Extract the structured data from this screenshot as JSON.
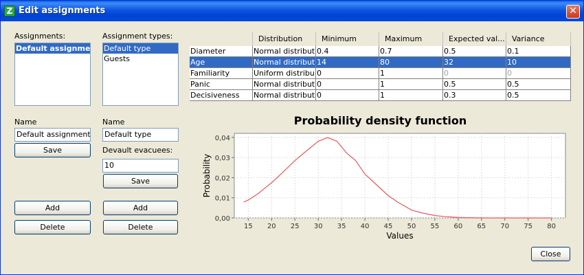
{
  "window": {
    "title": "Edit assignments",
    "app_icon_letter": "Z",
    "close_glyph": "✕"
  },
  "assignments": {
    "label": "Assignments:",
    "items": [
      {
        "label": "Default assignment",
        "selected": true
      }
    ]
  },
  "assignment_types": {
    "label": "Assignment types:",
    "items": [
      {
        "label": "Default type",
        "selected": true
      },
      {
        "label": "Guests",
        "selected": false
      }
    ]
  },
  "assignment_form": {
    "name_label": "Name",
    "name_value": "Default assignment",
    "save_label": "Save",
    "add_label": "Add",
    "delete_label": "Delete"
  },
  "type_form": {
    "name_label": "Name",
    "name_value": "Default type",
    "evacuees_label": "Devault evacuees:",
    "evacuees_value": "10",
    "save_label": "Save",
    "add_label": "Add",
    "delete_label": "Delete"
  },
  "table": {
    "columns": [
      "",
      "Distribution",
      "Minimum",
      "Maximum",
      "Expected val...",
      "Variance"
    ],
    "rows": [
      {
        "cells": [
          "Diameter",
          "Normal distribution",
          "0.4",
          "0.7",
          "0.5",
          "0.1"
        ],
        "selected": false,
        "dim": []
      },
      {
        "cells": [
          "Age",
          "Normal distribution",
          "14",
          "80",
          "32",
          "10"
        ],
        "selected": true,
        "dim": []
      },
      {
        "cells": [
          "Familiarity",
          "Uniform distribu...",
          "0",
          "1",
          "0",
          "0"
        ],
        "selected": false,
        "dim": [
          4,
          5
        ]
      },
      {
        "cells": [
          "Panic",
          "Normal distribution",
          "0",
          "1",
          "0.5",
          "0.5"
        ],
        "selected": false,
        "dim": []
      },
      {
        "cells": [
          "Decisiveness",
          "Normal distribution",
          "0",
          "1",
          "0.3",
          "0.5"
        ],
        "selected": false,
        "dim": []
      }
    ]
  },
  "chart_data": {
    "type": "line",
    "title": "Probability density function",
    "xlabel": "Values",
    "ylabel": "Probability",
    "xlim": [
      12,
      83
    ],
    "ylim": [
      0,
      0.042
    ],
    "x_ticks": [
      "15",
      "20",
      "25",
      "30",
      "35",
      "40",
      "45",
      "50",
      "55",
      "60",
      "65",
      "70",
      "75",
      "80"
    ],
    "y_ticks": [
      "0,00",
      "0,01",
      "0,02",
      "0,03",
      "0,04"
    ],
    "grid": true,
    "line_color": "#E8585C",
    "x": [
      14,
      15,
      17,
      20,
      22,
      25,
      27,
      30,
      32,
      34,
      36,
      38,
      40,
      42,
      45,
      47,
      50,
      52,
      55,
      57,
      60,
      62,
      65,
      67,
      70,
      72,
      75,
      78,
      80
    ],
    "y": [
      0.0079,
      0.0089,
      0.0119,
      0.0175,
      0.0218,
      0.0285,
      0.0324,
      0.0381,
      0.0399,
      0.0381,
      0.0324,
      0.0285,
      0.0218,
      0.0175,
      0.0111,
      0.0079,
      0.0039,
      0.0026,
      0.0012,
      0.0007,
      0.00025,
      0.00012,
      3e-05,
      1e-05,
      0.0,
      0.0,
      0.0,
      0.0,
      0.0
    ]
  },
  "close_button": {
    "label": "Close"
  }
}
